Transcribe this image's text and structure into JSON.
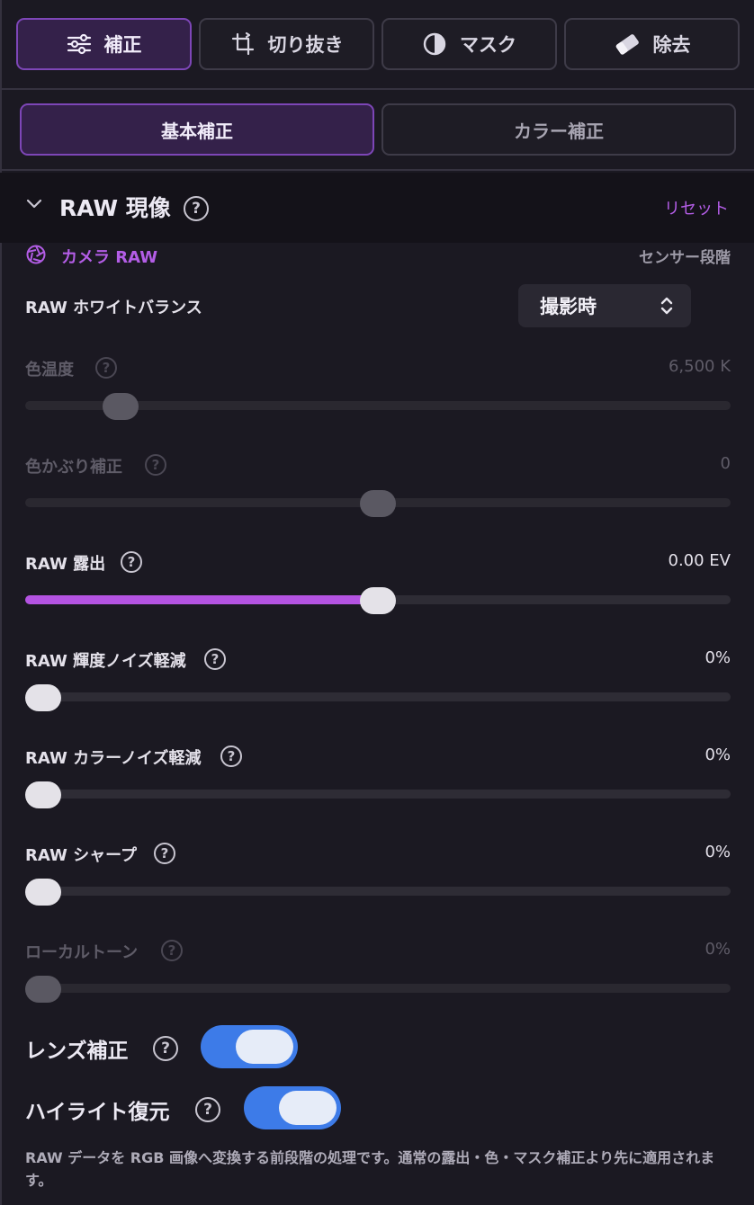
{
  "tool_tabs": [
    {
      "label": "補正",
      "icon": "sliders-icon"
    },
    {
      "label": "切り抜き",
      "icon": "crop-icon"
    },
    {
      "label": "マスク",
      "icon": "contrast-icon"
    },
    {
      "label": "除去",
      "icon": "eraser-icon"
    }
  ],
  "active_tool_tab": "補正",
  "sub_tabs": [
    "基本補正",
    "カラー補正"
  ],
  "active_sub_tab": "基本補正",
  "section": {
    "title": "RAW 現像",
    "reset_label": "リセット",
    "help_glyph": "?"
  },
  "camera": {
    "label": "カメラ RAW",
    "icon": "aperture-icon",
    "sensor_label": "センサー段階"
  },
  "white_balance": {
    "label": "RAW ホワイトバランス",
    "selected": "撮影時"
  },
  "sliders": [
    {
      "key": "temp",
      "label": "色温度",
      "value": "6,500 K",
      "position": 0.115,
      "disabled": true,
      "filled": false
    },
    {
      "key": "tint",
      "label": "色かぶり補正",
      "value": "0",
      "position": 0.5,
      "disabled": true,
      "filled": false
    },
    {
      "key": "exposure",
      "label": "RAW 露出",
      "value": "0.00 EV",
      "position": 0.5,
      "disabled": false,
      "filled": true
    },
    {
      "key": "luma_nr",
      "label": "RAW 輝度ノイズ軽減",
      "value": "0%",
      "position": 0.0,
      "disabled": false,
      "filled": false
    },
    {
      "key": "color_nr",
      "label": "RAW カラーノイズ軽減",
      "value": "0%",
      "position": 0.0,
      "disabled": false,
      "filled": false
    },
    {
      "key": "sharpen",
      "label": "RAW シャープ",
      "value": "0%",
      "position": 0.0,
      "disabled": false,
      "filled": false
    },
    {
      "key": "local_tone",
      "label": "ローカルトーン",
      "value": "0%",
      "position": 0.0,
      "disabled": true,
      "filled": false
    }
  ],
  "toggles": [
    {
      "key": "lens",
      "label": "レンズ補正",
      "on": true
    },
    {
      "key": "highlight",
      "label": "ハイライト復元",
      "on": true
    }
  ],
  "footnote": "RAW データを RGB 画像へ変換する前段階の処理です。通常の露出・色・マスク補正より先に適用されます。",
  "colors": {
    "accent": "#b453e2",
    "toggle_on": "#3d7be8",
    "background": "#1b1922"
  }
}
